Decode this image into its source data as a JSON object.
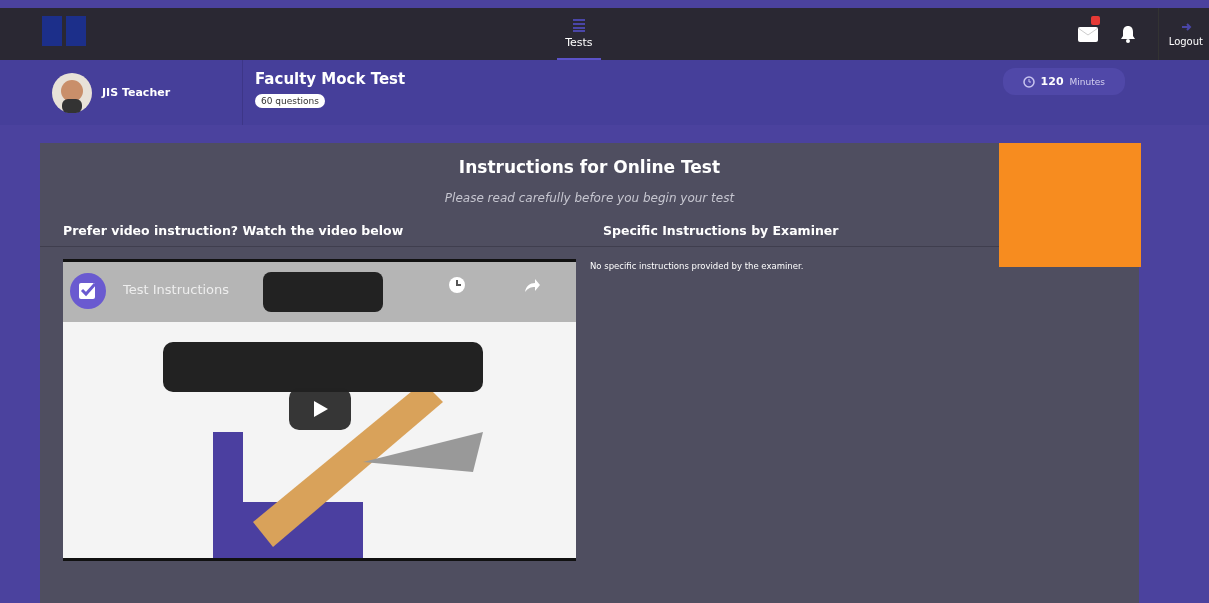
{
  "topbar": {
    "nav": {
      "label": "Tests",
      "selected": true
    },
    "mail_badge": true,
    "logout": "Logout"
  },
  "header": {
    "user": "JIS Teacher",
    "test_title": "Faculty Mock Test",
    "question_count": "60 questions",
    "duration_value": "120",
    "duration_unit": "Minutes"
  },
  "instructions": {
    "title": "Instructions for Online Test",
    "subtitle": "Please read carefully before you begin your test",
    "video_heading": "Prefer video instruction? Watch the video below",
    "video": {
      "kind": "picture",
      "channel_title": "Test Instructions"
    },
    "examiner_heading": "Specific Instructions by Examiner",
    "examiner_text": "No specific instructions provided by the examiner."
  }
}
